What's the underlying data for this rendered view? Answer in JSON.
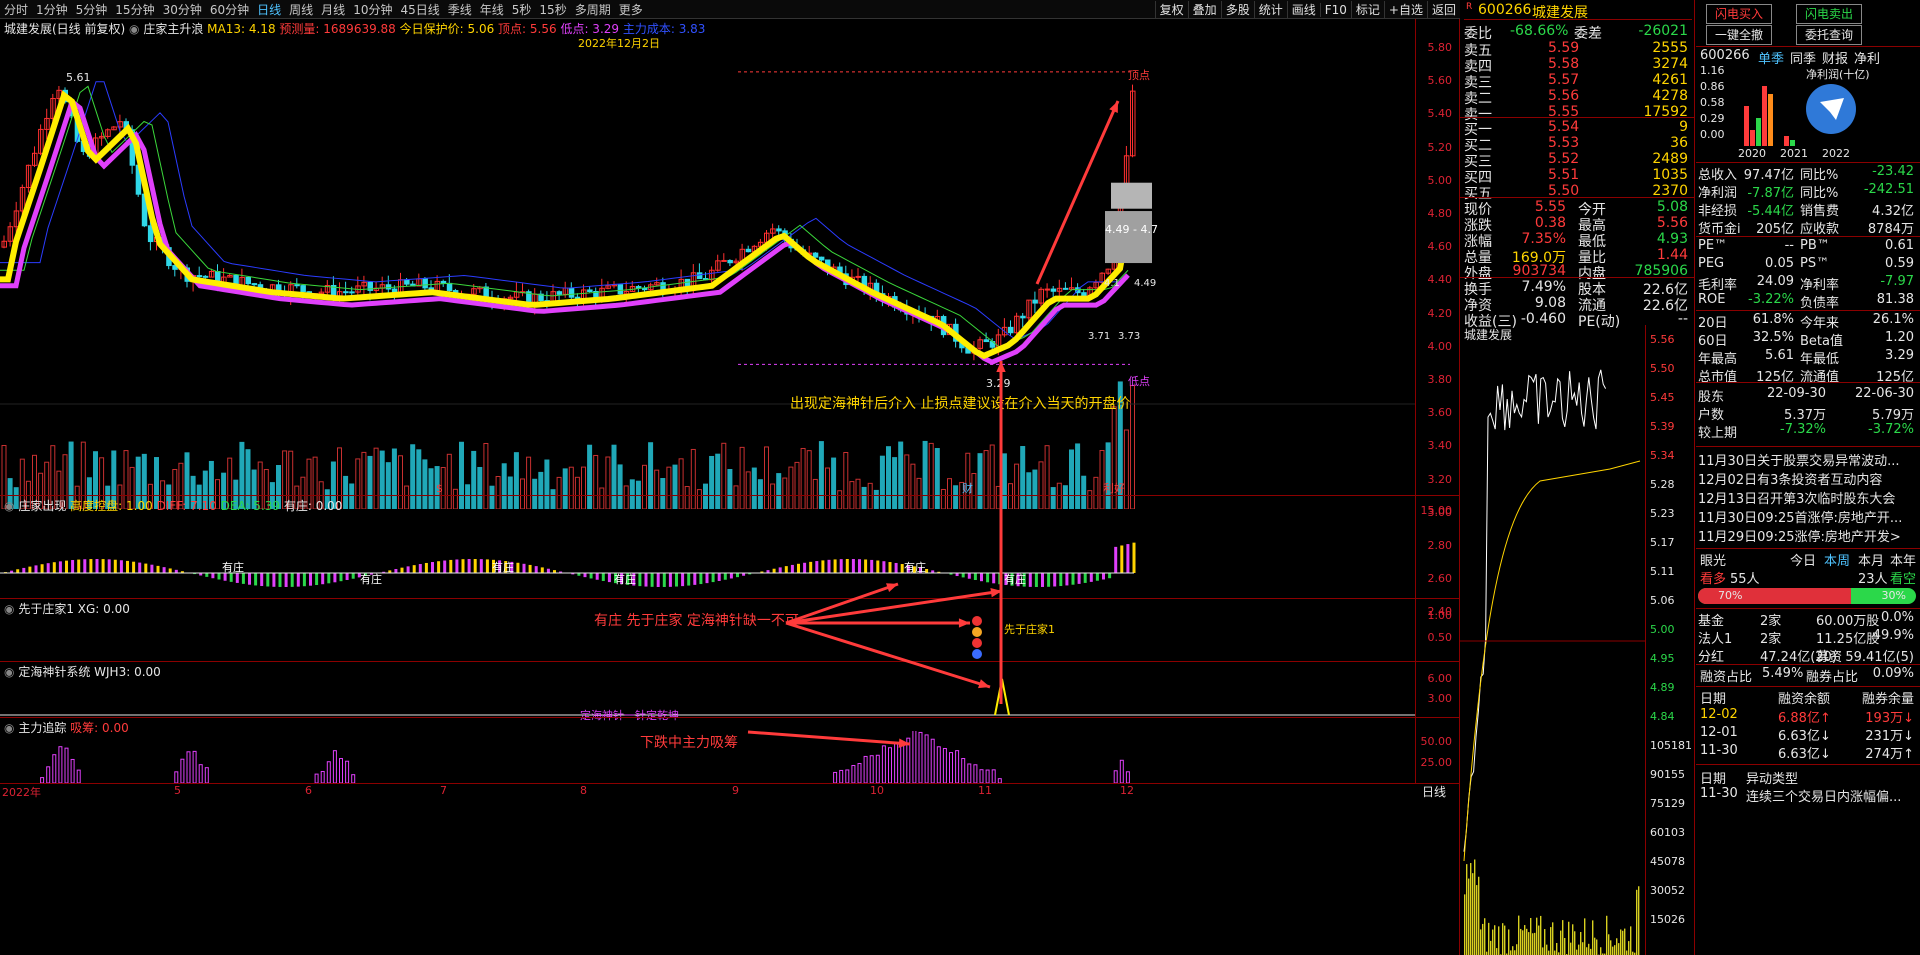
{
  "toolbar": {
    "periods": [
      "分时",
      "1分钟",
      "5分钟",
      "15分钟",
      "30分钟",
      "60分钟",
      "日线",
      "周线",
      "月线",
      "10分钟",
      "45日线",
      "季线",
      "年线",
      "5秒",
      "15秒",
      "多周期",
      "更多"
    ],
    "tools": [
      "复权",
      "叠加",
      "多股",
      "统计",
      "画线",
      "F10",
      "标记",
      "+自选",
      "返回"
    ]
  },
  "chart": {
    "header": {
      "name": "城建发展(日线 前复权)",
      "indicator": "庄家主升浪",
      "ma13": "MA13: 4.18",
      "pred": "预测量: 1689639.88",
      "protect": "今日保护价: 5.06",
      "top": "顶点: 5.56",
      "low": "低点: 3.29",
      "cost": "主力成本: 3.83"
    },
    "date_label": "2022年12月2日",
    "price_ticks": [
      "5.80",
      "5.60",
      "5.40",
      "5.20",
      "5.00",
      "4.80",
      "4.60",
      "4.40",
      "4.20",
      "4.00",
      "3.80",
      "3.60",
      "3.40",
      "3.20",
      "3.00",
      "2.80",
      "2.60",
      "2.40"
    ],
    "high_label": "5.61",
    "low_label": "3.29",
    "top_marker": "顶点",
    "low_marker": "低点",
    "box_text": "4.49 - 4.7",
    "label_373a": "3.71",
    "label_373b": "3.73",
    "label_449": "4.49",
    "label_41": "4.1",
    "annotation_main": "出现定海神针后介入 止损点建议设在介入当天的开盘价",
    "vol_markers": [
      "$",
      "财",
      "利好"
    ],
    "panels": {
      "p1": {
        "name": "庄家出现",
        "a": "高度控盘: 1.00",
        "b": "DIFF: 7.10",
        "c": "DEA: 5.39",
        "d": "有庄: 0.00",
        "label": "有庄",
        "ticks": [
          "15.00"
        ]
      },
      "p2": {
        "name": "先于庄家1",
        "a": "XG: 0.00",
        "label": "先于庄家1",
        "ticks": [
          "1.00",
          "0.50"
        ]
      },
      "p3": {
        "name": "定海神针系统",
        "a": "WJH3: 0.00",
        "label": "定海神针一针定乾坤",
        "ticks": [
          "6.00",
          "3.00"
        ]
      },
      "p4": {
        "name": "主力追踪",
        "a": "吸筹: 0.00",
        "ticks": [
          "50.00",
          "25.00"
        ]
      }
    },
    "annotation_p2": "有庄 先于庄家 定海神针缺一不可",
    "annotation_p4": "下跌中主力吸筹",
    "xaxis": [
      "2022年",
      "5",
      "6",
      "7",
      "8",
      "9",
      "10",
      "11",
      "12"
    ],
    "day_label": "日线"
  },
  "quote": {
    "code": "600266",
    "name": "城建发展",
    "rmark": "R",
    "webi": {
      "label": "委比",
      "value": "-68.66%",
      "label2": "委差",
      "value2": "-26021"
    },
    "sells": [
      {
        "l": "卖五",
        "p": "5.59",
        "v": "2555"
      },
      {
        "l": "卖四",
        "p": "5.58",
        "v": "3274"
      },
      {
        "l": "卖三",
        "p": "5.57",
        "v": "4261"
      },
      {
        "l": "卖二",
        "p": "5.56",
        "v": "4278"
      },
      {
        "l": "卖一",
        "p": "5.55",
        "v": "17592"
      }
    ],
    "buys": [
      {
        "l": "买一",
        "p": "5.54",
        "v": "9"
      },
      {
        "l": "买二",
        "p": "5.53",
        "v": "36"
      },
      {
        "l": "买三",
        "p": "5.52",
        "v": "2489"
      },
      {
        "l": "买四",
        "p": "5.51",
        "v": "1035"
      },
      {
        "l": "买五",
        "p": "5.50",
        "v": "2370"
      }
    ],
    "stats": [
      {
        "l": "现价",
        "v": "5.55",
        "l2": "今开",
        "v2": "5.08"
      },
      {
        "l": "涨跌",
        "v": "0.38",
        "l2": "最高",
        "v2": "5.56"
      },
      {
        "l": "涨幅",
        "v": "7.35%",
        "l2": "最低",
        "v2": "4.93"
      },
      {
        "l": "总量",
        "v": "169.0万",
        "l2": "量比",
        "v2": "1.44"
      },
      {
        "l": "外盘",
        "v": "903734",
        "l2": "内盘",
        "v2": "785906"
      }
    ],
    "stats2": [
      {
        "l": "换手",
        "v": "7.49%",
        "l2": "股本",
        "v2": "22.6亿"
      },
      {
        "l": "净资",
        "v": "9.08",
        "l2": "流通",
        "v2": "22.6亿"
      },
      {
        "l": "收益(三)",
        "v": "-0.460",
        "l2": "PE(动)",
        "v2": "--"
      }
    ],
    "mini_title": "城建发展",
    "mini_ticks": [
      "5.56",
      "5.50",
      "5.45",
      "5.39",
      "5.34",
      "5.28",
      "5.23",
      "5.17",
      "5.11",
      "5.06",
      "5.00",
      "4.95",
      "4.89",
      "4.84",
      "105181",
      "90155",
      "75129",
      "60103",
      "45078",
      "30052",
      "15026"
    ]
  },
  "info": {
    "buy_btn": "闪电买入",
    "sell_btn": "闪电卖出",
    "cancel_btn": "一键全撤",
    "query_btn": "委托查询",
    "code": "600266",
    "tabs": [
      "单季",
      "同季",
      "财报",
      "净利"
    ],
    "fin_title": "净利润(十亿)",
    "fin_ticks": [
      "1.16",
      "0.86",
      "0.58",
      "0.29",
      "0.00"
    ],
    "years": [
      "2020",
      "2021",
      "2022"
    ],
    "rows1": [
      {
        "l": "总收入",
        "v": "97.47亿",
        "l2": "同比%",
        "v2": "-23.42"
      },
      {
        "l": "净利润",
        "v": "-7.87亿",
        "l2": "同比%",
        "v2": "-242.51"
      },
      {
        "l": "非经损",
        "v": "-5.44亿",
        "l2": "销售费",
        "v2": "4.32亿"
      },
      {
        "l": "货币金i",
        "v": "205亿",
        "l2": "应收款",
        "v2": "8784万"
      }
    ],
    "rows2": [
      {
        "l": "PE™",
        "v": "--",
        "l2": "PB™",
        "v2": "0.61"
      },
      {
        "l": "PEG",
        "v": "0.05",
        "l2": "PS™",
        "v2": "0.59"
      },
      {
        "l": "毛利率",
        "v": "24.09",
        "l2": "净利率",
        "v2": "-7.97"
      },
      {
        "l": "ROE",
        "v": "-3.22%",
        "l2": "负债率",
        "v2": "81.38"
      }
    ],
    "rows3": [
      {
        "l": "20日",
        "v": "61.8%",
        "l2": "今年来",
        "v2": "26.1%"
      },
      {
        "l": "60日",
        "v": "32.5%",
        "l2": "Beta值",
        "v2": "1.20"
      },
      {
        "l": "年最高",
        "v": "5.61",
        "l2": "年最低",
        "v2": "3.29"
      },
      {
        "l": "总市值",
        "v": "125亿",
        "l2": "流通值",
        "v2": "125亿"
      }
    ],
    "holders": [
      {
        "l": "股东",
        "v": "22-09-30",
        "v2": "22-06-30"
      },
      {
        "l": "户数",
        "v": "5.37万",
        "v2": "5.79万"
      },
      {
        "l": "较上期",
        "v": "-7.32%",
        "v2": "-3.72%"
      }
    ],
    "news": [
      "11月30日关于股票交易异常波动...",
      "12月02日有3条投资者互动内容",
      "12月13日召开第3次临时股东大会",
      "11月30日09:25首涨停:房地产开...",
      "11月29日09:25涨停:房地产开发>"
    ],
    "eye": {
      "label": "眼光",
      "tabs": [
        "今日",
        "本周",
        "本月",
        "本年"
      ],
      "bull": "看多",
      "bull_n": "55人",
      "bear_n": "23人",
      "bear": "看空",
      "bull_pct": "70%",
      "bear_pct": "30%",
      "bull_frac": 0.7
    },
    "fund": [
      {
        "l": "基金",
        "v": "2家",
        "v2": "60.00万股",
        "v3": "0.0%"
      },
      {
        "l": "法人1",
        "v": "2家",
        "v2": "11.25亿股",
        "v3": "49.9%"
      },
      {
        "l": "分红",
        "v": "47.24亿(20)",
        "v2": "募资",
        "v3": "59.41亿(5)"
      }
    ],
    "margin": {
      "a": "融资占比",
      "b": "5.49%",
      "c": "融券占比",
      "d": "0.09%"
    },
    "margin_hdr": [
      "日期",
      "融资余额",
      "融券余量"
    ],
    "margin_rows": [
      {
        "d": "12-02",
        "a": "6.88亿↑",
        "b": "193万↓"
      },
      {
        "d": "12-01",
        "a": "6.63亿↓",
        "b": "231万↓"
      },
      {
        "d": "11-30",
        "a": "6.63亿↓",
        "b": "274万↑"
      }
    ],
    "abn_hdr": [
      "日期",
      "异动类型"
    ],
    "abn_row": {
      "d": "11-30",
      "t": "连续三个交易日内涨幅偏..."
    }
  },
  "colors": {
    "up": "#ff3b3b",
    "down": "#2bd84a",
    "accent": "#4fc3ff",
    "border": "#8b0000"
  }
}
